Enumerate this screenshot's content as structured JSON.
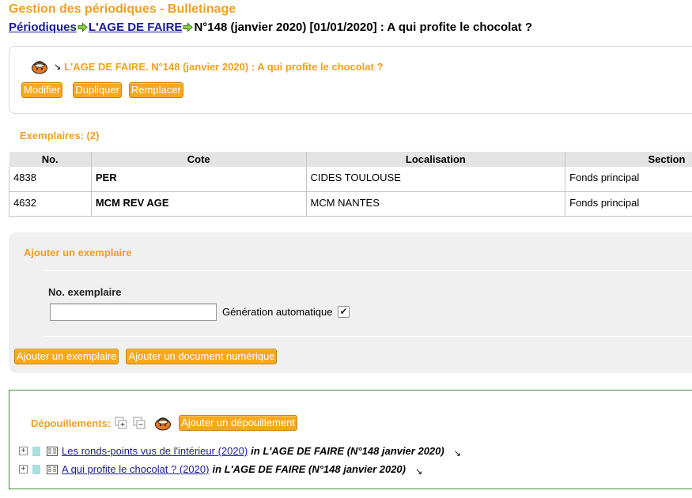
{
  "page": {
    "title": "Gestion des périodiques - Bulletinage"
  },
  "breadcrumb": {
    "items": [
      "Périodiques",
      "L'AGE DE FAIRE"
    ],
    "current": "N°148 (janvier 2020) [01/01/2020] : A qui profite le chocolat ?"
  },
  "bulletin": {
    "notice_title": "L'AGE DE FAIRE. N°148 (janvier 2020) : A qui profite le chocolat ?",
    "buttons": {
      "modify": "Modifier",
      "duplicate": "Dupliquer",
      "replace": "Remplacer"
    }
  },
  "exemplaires": {
    "label": "Exemplaires: (2)",
    "columns": [
      "No.",
      "Cote",
      "Localisation",
      "Section"
    ],
    "rows": [
      {
        "no": "4838",
        "cote": "PER",
        "localisation": "CIDES TOULOUSE",
        "section": "Fonds principal"
      },
      {
        "no": "4632",
        "cote": "MCM REV AGE",
        "localisation": "MCM NANTES",
        "section": "Fonds principal"
      }
    ]
  },
  "add_exemplaire": {
    "title": "Ajouter un exemplaire",
    "field_label": "No. exemplaire",
    "field_value": "",
    "auto_label": "Génération automatique",
    "auto_checked": true,
    "buttons": {
      "add": "Ajouter un exemplaire",
      "add_digital": "Ajouter un document numérique"
    }
  },
  "depouillements": {
    "label": "Dépouillements:",
    "add_button": "Ajouter un dépouillement",
    "items": [
      {
        "title": "Les ronds-points vus de l'intérieur (2020)",
        "in": "in L'AGE DE FAIRE (N°148 janvier 2020)"
      },
      {
        "title": "A qui profite le chocolat ? (2020)",
        "in": "in L'AGE DE FAIRE (N°148 janvier 2020)"
      }
    ]
  },
  "colors": {
    "accent": "#f0a020",
    "button": "#f7a81d",
    "link": "#1a1a99",
    "depouillement_border": "#4a8a3a",
    "item_marker": "#a8dede"
  }
}
